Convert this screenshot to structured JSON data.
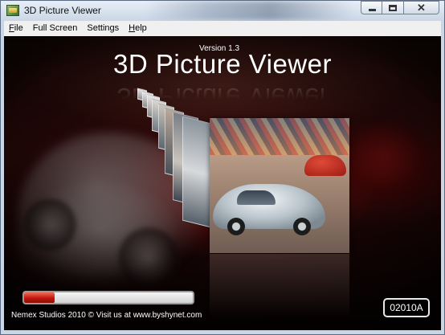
{
  "window": {
    "title": "3D Picture Viewer",
    "buttons": {
      "minimize": "minimize",
      "maximize": "maximize",
      "close": "✕"
    }
  },
  "menu": [
    {
      "label": "File",
      "accel": "F",
      "rest": "ile"
    },
    {
      "label": "Full Screen",
      "accel": "",
      "rest": "Full Screen"
    },
    {
      "label": "Settings",
      "accel": "",
      "rest": "Settings"
    },
    {
      "label": "Help",
      "accel": "H",
      "rest": "elp"
    }
  ],
  "viewer": {
    "version": "Version 1.3",
    "title": "3D Picture Viewer",
    "progress_fraction": 0.18,
    "credit": "Nemex Studios 2010 © Visit us at www.byshynet.com",
    "counter": "02010A"
  },
  "colors": {
    "accent_red": "#c0160b",
    "frame": "#c9d6e6"
  },
  "icons": [
    "app-icon",
    "minimize-icon",
    "maximize-icon",
    "close-icon"
  ]
}
